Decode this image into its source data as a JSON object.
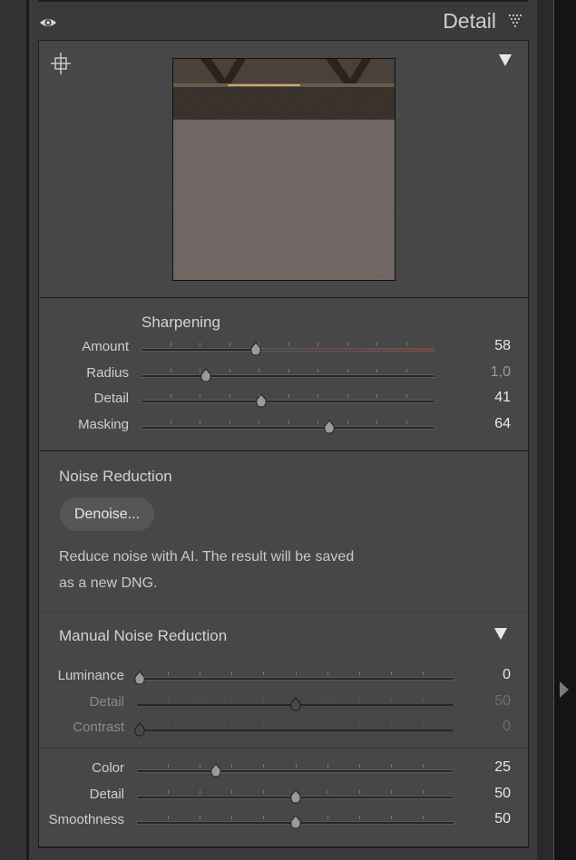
{
  "panel": {
    "title": "Detail"
  },
  "sharpening": {
    "label": "Sharpening",
    "sliders": [
      {
        "label": "Amount",
        "value": "58",
        "position": 0.39,
        "accent": "#8a3a3a",
        "enabled": true
      },
      {
        "label": "Radius",
        "value": "1,0",
        "position": 0.22,
        "enabled": true,
        "value_dim": true
      },
      {
        "label": "Detail",
        "value": "41",
        "position": 0.41,
        "enabled": true
      },
      {
        "label": "Masking",
        "value": "64",
        "position": 0.64,
        "enabled": true
      }
    ]
  },
  "noise_reduction": {
    "label": "Noise Reduction",
    "denoise_button": "Denoise...",
    "description_line1": "Reduce noise with AI. The result will be saved",
    "description_line2": "as a new DNG."
  },
  "manual_noise_reduction": {
    "label": "Manual Noise Reduction",
    "sliders": [
      {
        "label": "Luminance",
        "value": "0",
        "position": 0.0,
        "enabled": true
      },
      {
        "label": "Detail",
        "value": "50",
        "position": 0.5,
        "enabled": false
      },
      {
        "label": "Contrast",
        "value": "0",
        "position": 0.0,
        "enabled": false
      }
    ],
    "color_sliders": [
      {
        "label": "Color",
        "value": "25",
        "position": 0.25,
        "enabled": true
      },
      {
        "label": "Detail",
        "value": "50",
        "position": 0.5,
        "enabled": true
      },
      {
        "label": "Smoothness",
        "value": "50",
        "position": 0.5,
        "enabled": true
      }
    ]
  },
  "icons": {
    "visibility": "eye-icon",
    "panel_menu": "panel-menu-icon",
    "target": "target-adjustment-icon",
    "collapse": "triangle-down-icon",
    "side_expand": "triangle-right-icon"
  },
  "colors": {
    "panel_bg": "#3a3a3a",
    "section_bg": "#474747",
    "amount_fill": "#8a3a3a"
  }
}
